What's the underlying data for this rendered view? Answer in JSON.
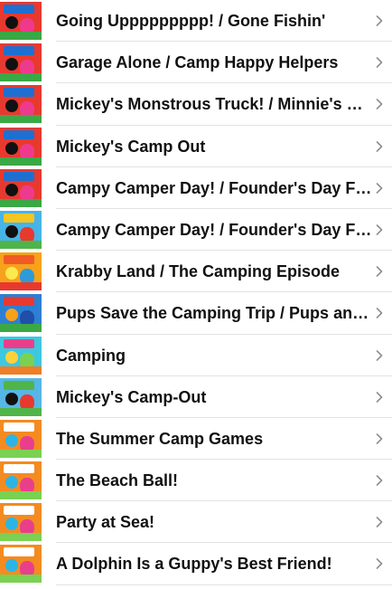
{
  "episodes": [
    {
      "title": "Going Uppppppppp! / Gone Fishin'",
      "thumb": "mickey-roadster-racers",
      "sky": "#e8392f",
      "banner": "#1f6fd1",
      "blob1": "#111111",
      "blob2": "#ee3a8c",
      "ground": "#3aa845"
    },
    {
      "title": "Garage Alone / Camp Happy Helpers",
      "thumb": "mickey-roadster-racers",
      "sky": "#e8392f",
      "banner": "#1f6fd1",
      "blob1": "#111111",
      "blob2": "#ee3a8c",
      "ground": "#3aa845"
    },
    {
      "title": "Mickey's Monstrous Truck! / Minnie's Vacation",
      "thumb": "mickey-roadster-racers",
      "sky": "#e8392f",
      "banner": "#1f6fd1",
      "blob1": "#111111",
      "blob2": "#ee3a8c",
      "ground": "#3aa845"
    },
    {
      "title": "Mickey's Camp Out",
      "thumb": "mickey-roadster-racers",
      "sky": "#e8392f",
      "banner": "#1f6fd1",
      "blob1": "#111111",
      "blob2": "#ee3a8c",
      "ground": "#3aa845"
    },
    {
      "title": "Campy Camper Day! / Founder's Day Flounder",
      "thumb": "mickey-roadster-racers",
      "sky": "#e8392f",
      "banner": "#1f6fd1",
      "blob1": "#111111",
      "blob2": "#ee3a8c",
      "ground": "#3aa845"
    },
    {
      "title": "Campy Camper Day! / Founder's Day Flounder",
      "thumb": "mickey-clubhouse",
      "sky": "#47b4e8",
      "banner": "#f3c623",
      "blob1": "#111111",
      "blob2": "#e8392f",
      "ground": "#4fb548"
    },
    {
      "title": "Krabby Land / The Camping Episode",
      "thumb": "spongebob",
      "sky": "#f7a21b",
      "banner": "#f15a24",
      "blob1": "#fce94f",
      "blob2": "#2f9ad8",
      "ground": "#e8392f"
    },
    {
      "title": "Pups Save the Camping Trip / Pups and the Ghost Pirate",
      "thumb": "paw-patrol",
      "sky": "#2d7fd3",
      "banner": "#e8392f",
      "blob1": "#f7a21b",
      "blob2": "#1f4fa8",
      "ground": "#3aa845"
    },
    {
      "title": "Camping",
      "thumb": "bubble-guppies",
      "sky": "#3dc8e0",
      "banner": "#e93f8b",
      "blob1": "#fcd23a",
      "blob2": "#7ad152",
      "ground": "#f17d27"
    },
    {
      "title": "Mickey's Camp-Out",
      "thumb": "mickey-clubhouse",
      "sky": "#56b7e6",
      "banner": "#4fb548",
      "blob1": "#111111",
      "blob2": "#e8392f",
      "ground": "#4fb548"
    },
    {
      "title": "The Summer Camp Games",
      "thumb": "supper-camp",
      "sky": "#f48b21",
      "banner": "#ffffff",
      "blob1": "#2bb5e6",
      "blob2": "#e93f8b",
      "ground": "#7ad152"
    },
    {
      "title": "The Beach Ball!",
      "thumb": "supper-camp",
      "sky": "#f48b21",
      "banner": "#ffffff",
      "blob1": "#2bb5e6",
      "blob2": "#e93f8b",
      "ground": "#7ad152"
    },
    {
      "title": "Party at Sea!",
      "thumb": "supper-camp",
      "sky": "#f48b21",
      "banner": "#ffffff",
      "blob1": "#2bb5e6",
      "blob2": "#e93f8b",
      "ground": "#7ad152"
    },
    {
      "title": "A Dolphin Is a Guppy's Best Friend!",
      "thumb": "supper-camp",
      "sky": "#f48b21",
      "banner": "#ffffff",
      "blob1": "#2bb5e6",
      "blob2": "#e93f8b",
      "ground": "#7ad152"
    }
  ],
  "chevron_icon": "chevron-right-icon",
  "colors": {
    "text": "#111111",
    "chevron": "#8e8e93",
    "separator": "#e3e3e6",
    "background": "#ffffff"
  }
}
